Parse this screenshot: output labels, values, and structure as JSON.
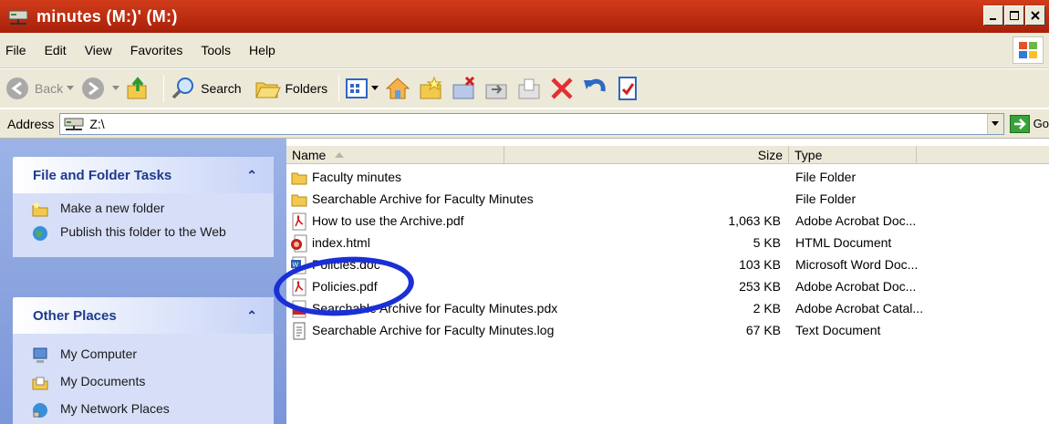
{
  "window": {
    "title": "minutes (M:)' (M:)"
  },
  "menu": {
    "items": [
      "File",
      "Edit",
      "View",
      "Favorites",
      "Tools",
      "Help"
    ]
  },
  "toolbar": {
    "back_label": "Back",
    "search_label": "Search",
    "folders_label": "Folders"
  },
  "address": {
    "label": "Address",
    "value": "Z:\\",
    "go_label": "Go"
  },
  "tasks": {
    "file_folder": {
      "title": "File and Folder Tasks",
      "items": [
        "Make a new folder",
        "Publish this folder to the Web"
      ]
    },
    "other_places": {
      "title": "Other Places",
      "items": [
        "My Computer",
        "My Documents",
        "My Network Places"
      ]
    }
  },
  "columns": {
    "name": "Name",
    "size": "Size",
    "type": "Type"
  },
  "files": [
    {
      "name": "Faculty minutes",
      "size": "",
      "type": "File Folder",
      "icon": "folder-icon"
    },
    {
      "name": "Searchable Archive for Faculty Minutes",
      "size": "",
      "type": "File Folder",
      "icon": "folder-icon"
    },
    {
      "name": "How to use the Archive.pdf",
      "size": "1,063 KB",
      "type": "Adobe Acrobat Doc...",
      "icon": "pdf-icon"
    },
    {
      "name": "index.html",
      "size": "5 KB",
      "type": "HTML Document",
      "icon": "html-icon"
    },
    {
      "name": "Policies.doc",
      "size": "103 KB",
      "type": "Microsoft Word Doc...",
      "icon": "word-icon"
    },
    {
      "name": "Policies.pdf",
      "size": "253 KB",
      "type": "Adobe Acrobat Doc...",
      "icon": "pdf-icon"
    },
    {
      "name": "Searchable Archive for Faculty Minutes.pdx",
      "size": "2 KB",
      "type": "Adobe Acrobat Catal...",
      "icon": "pdx-icon"
    },
    {
      "name": "Searchable Archive for Faculty Minutes.log",
      "size": "67 KB",
      "type": "Text Document",
      "icon": "text-icon"
    }
  ],
  "colors": {
    "titlebar": "#c0301a",
    "panel_bg": "#d6dff7",
    "pane_bg": "#7b96d9",
    "annotation_circle": "#1a2fd6"
  }
}
